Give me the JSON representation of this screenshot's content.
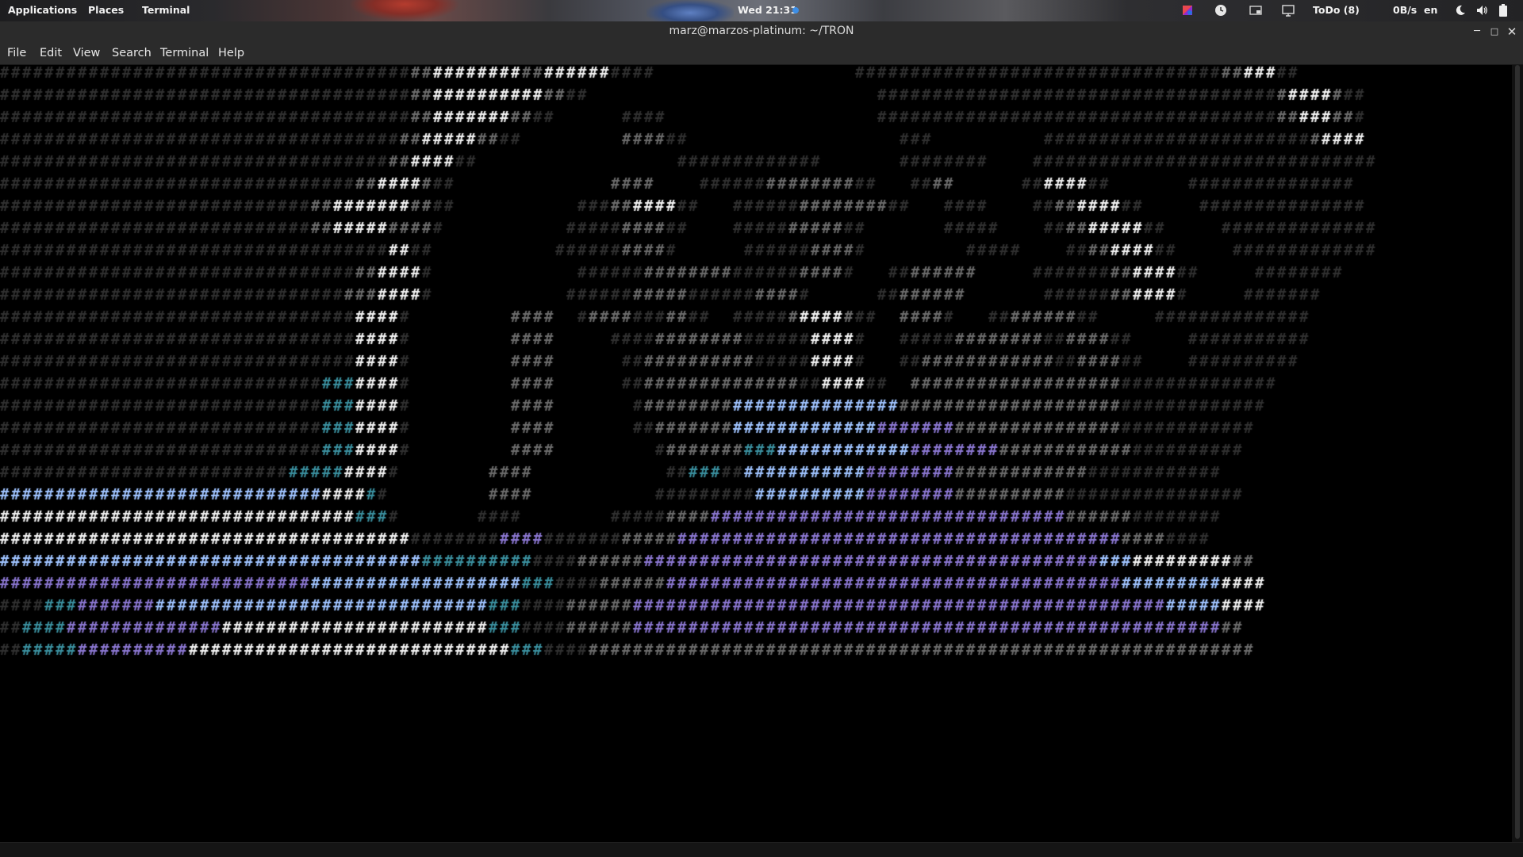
{
  "panel": {
    "applications": "Applications",
    "places": "Places",
    "terminal": "Terminal",
    "clock": "Wed 21:31",
    "todo": "ToDo (8)",
    "net_speed": "0B/s",
    "language": "en"
  },
  "window": {
    "title": "marz@marzos-platinum: ~/TRON"
  },
  "menu": {
    "file": "File",
    "edit": "Edit",
    "view": "View",
    "search": "Search",
    "terminal": "Terminal",
    "help": "Help"
  },
  "terminal": {
    "glyph": "#",
    "background": "#000000",
    "palette": {
      "dim": "#303030",
      "mid": "#6b6b6b",
      "bright": "#f2f2f2",
      "blue": "#5b7fd6",
      "lightblue": "#9fc3ff",
      "violet": "#8a76d0",
      "teal": "#3a8f9e",
      "cyan": "#8ce6ef"
    },
    "rows": [
      "dddddddddddddddddddddddddddddddddddddmmbbbbbbbbmmbbbbbbdddd                  dddddddddddddddddddddddddddddddddmmbbbdd    ",
      "dddddddddddddddddddddddddddddddddddddmmbbbbbbbbbbmmdd                          ddddddddddddddddddddddddddddddddddddmbbbbmdd ",
      "dddddddddddddddddddddddddddddddddddddmmbbbbbbbmmdd      dddd                   ddddddddddddddddddddddddddddddddddddmmbbbmmd ",
      "ddddddddddddddddddddddddddddddddddddmmbbbbbmmdd         mmmmdd                   ddd          ddddddddddddddddddddddddmbbbb ",
      "dddddddddddddddddddddddddddddddddddmmbbbbdd                  ddddddddddddd       dddddddd    ddddddddddddddddddddddddddddddd",
      "ddddddddddddddddddddddddddddddddmmbbbbmdd              mmmm    ddddddmmmmmmmmdd   ddmm      ddbbbbdd       ddddddddddddddd",
      "ddddddddddddddddddddddddddddmmbbbbbbbmmdd           dddmmbbbbdd   ddddddmmmmmmmmdd   dddd    ddmmbbbbdd     ddddddddddddddd",
      "ddddddddddddddddddddddddddddmmbbbbbmmmmd           dddddmmmmdd    dddddmmmmmdd       ddddd    ddmmbbbbbdd     dddddddddddddd",
      "dddddddddddddddddddddddddddddddddddbbdd           ddddddmmmmd      ddddddmmmmd         ddddd    ddmmbbbbdd     ddddddddddddd",
      "ddddddddddddddddddddddddddddddddmmbbbbd             ddddddmmmmmmmmddddddmmmmd   ddmmmmmm     dddddddmmbbbbdd     dddddddd",
      "dddddddddddddddddddddddddddddddmmmbbbbd            ddddddmmmmmddddddmmmmd      ddmmmmmm       ddddddmmbbbbd     ddddddd",
      "ddddddddddddddddddddddddddddddddbbbbd         mmmm  dmmmmdddmmdd  dddddmbbbbmdd  mmmmd   ddmmmmmmdd     dddddddddddddd",
      "ddddddddddddddddddddddddddddddddbbbbd         mmmm     ddddmmmmmmmmddddddbbbbd   dddddmmmmmmmmddmmmmdd     ddddddddddd",
      "ddddddddddddddddddddddddddddddddbbbbd         mmmm      ddmmmmmmmmmmdddddbbbbd   ddmmmmmmmmmmmmddmmmmdd    dddddddddd",
      "dddddddddddddddddddddddddddddtttbbbbd         mmmm      ddmmmmmmmmmmmmmmddbbbbdd  mmmmmmmmmmmmmmmmmmmdddddddddddddd",
      "dddddddddddddddddddddddddddddtttbbbbd         mmmm       dmmmmmmmmlllllllllllllllmmmmmmmmmmmmmmmmmmmmddddddddddddd",
      "dddddddddddddddddddddddddddddtttbbbbd         mmmm       ddmmmmmmmlllllllllllllvvvvvvvmmmmmmmmmmmmmmmdddddddddddd",
      "dddddddddddddddddddddddddddddtttbbbbd         mmmm         dmmmmmmmtttllllllllllllvvvvvvvvmmmmmmmmmmmmdddddddddd",
      "ddddddddddddddddddddddddddtttttbbbbd        mmmm            ddtttddlllllllllllvvvvvvvvmmmmmmmmmmmmdddddddddddd",
      "lllllllllllllllllllllllllllllbbbbtd         mmmm           dddddddddllllllllllvvvvvvvvmmmmmmmmmmdddddddddddddddd",
      "bbbbbbbbbbbbbbbbbbbbbbbbbbbbbbbbtttd       dddd        dddddmmmmvvvvvvvvvvvvvvvvvvvvvvvvvvvvvvvvmmmmmmdddddddd",
      "bbbbbbbbbbbbbbbbbbbbbbbbbbbbbbbbbbbbbddddddddvvvvdddddddmmmmmvvvvvvvvvvvvvvvvvvvvvvvvvvvvvvvvvvvvvvvvmmmmdddd",
      "llllllllllllllllllllllllllllllllllllllttttttttttddddmmmmmmvvvvvvvvvvvvvvvvvvvvvvvvvvvvvvvvvvvvvvvvvlllbbbbbbbbbmm",
      "vvvvvvvvvvvvvvvvvvvvvvvvvvvvllllllllllllllllllltttddddmmmmmmvvvvvvvvvvvvvvvvvvvvvvvvvvvvvvvvvvvvvvvvvlllllllllbbbb",
      "ddddtttvvvvvvvlllllllllllllllllllllllllllllltttddddmmmmmmvvvvvvvvvvvvvvvvvvvvvvvvvvvvvvvvvvvvvvvvvvvvvvvvlllllbbbb",
      "ddttttvvvvvvvvvvvvvvbbbbbbbbbbbbbbbbbbbbbbbbtttddddmmmmmmvvvvvvvvvvvvvvvvvvvvvvvvvvvvvvvvvvvvvvvvvvvvvvvvvvvvvmm",
      "ddtttttvvvvvvvvvvbbbbbbbbbbbbbbbbbbbbbbbbbbbbbtttddddmmmmmmmmmmmmmmmmmmmmmmmmmmmmmmmmmmmmmmmmmmmmmmmmmmmmmmmmmmmm"
    ]
  }
}
